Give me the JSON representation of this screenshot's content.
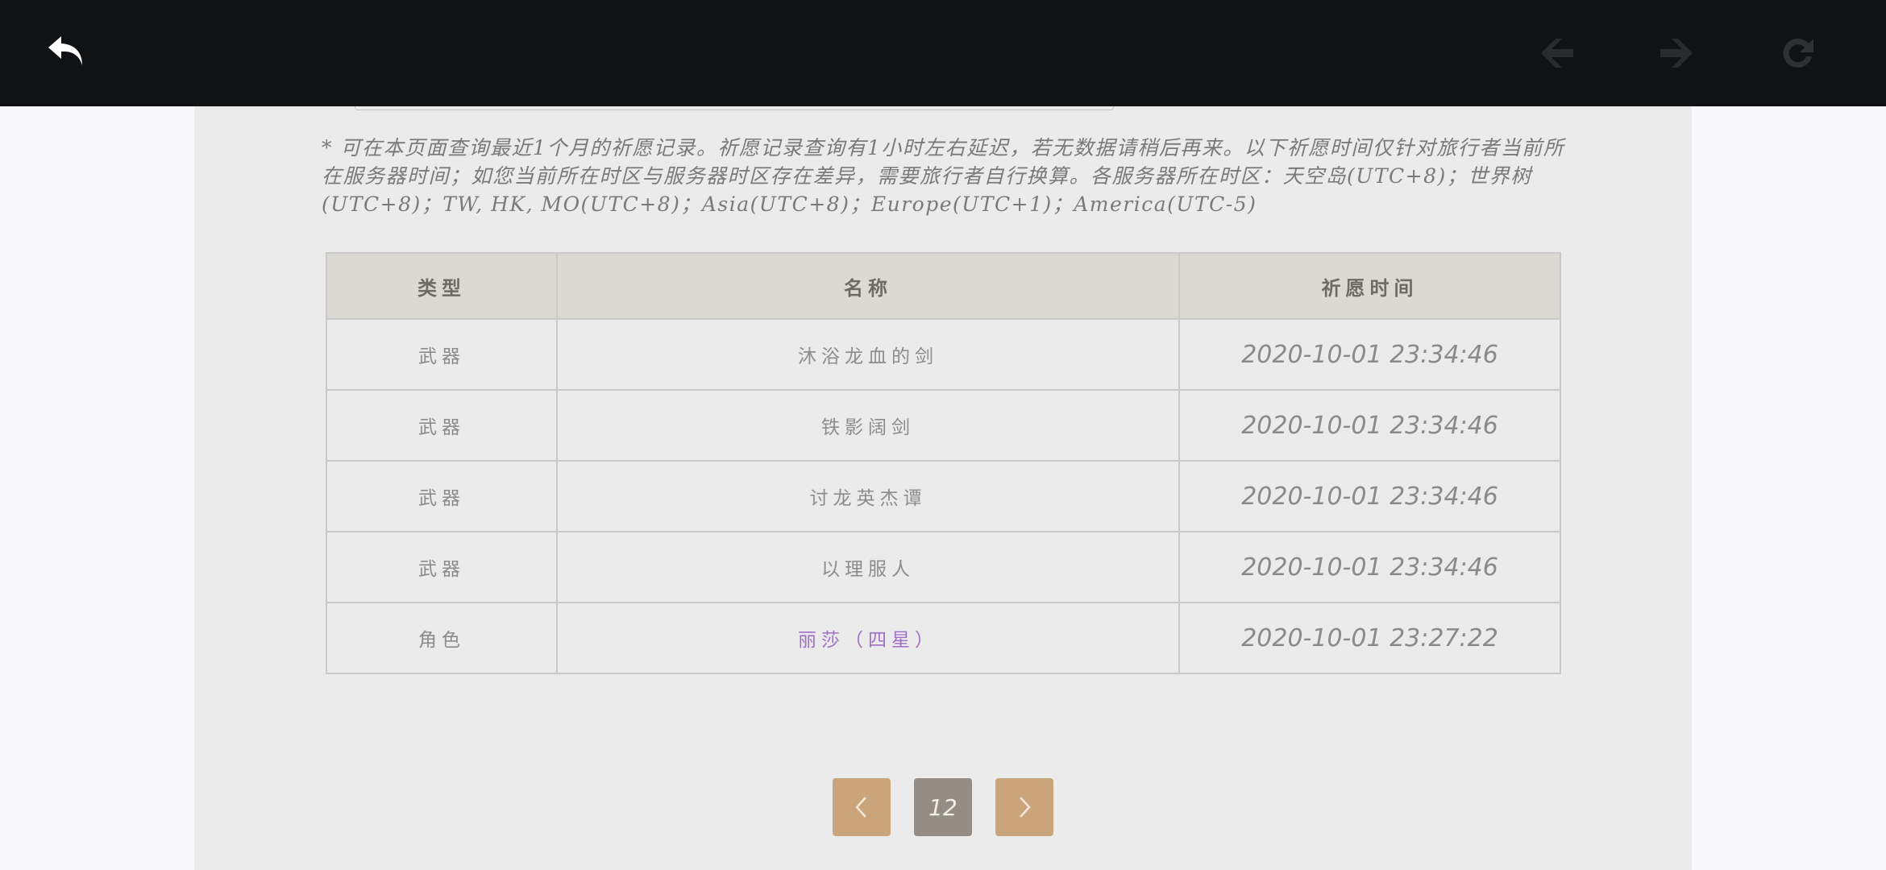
{
  "notice": "* 可在本页面查询最近1个月的祈愿记录。祈愿记录查询有1小时左右延迟，若无数据请稍后再来。以下祈愿时间仅针对旅行者当前所在服务器时间；如您当前所在时区与服务器时区存在差异，需要旅行者自行换算。各服务器所在时区：天空岛(UTC+8)；世界树(UTC+8)；TW, HK, MO(UTC+8)；Asia(UTC+8)；Europe(UTC+1)；America(UTC-5)",
  "table": {
    "headers": {
      "type": "类型",
      "name": "名称",
      "time": "祈愿时间"
    },
    "rows": [
      {
        "type": "武器",
        "name": "沐浴龙血的剑",
        "time": "2020-10-01 23:34:46",
        "highlight": false
      },
      {
        "type": "武器",
        "name": "铁影阔剑",
        "time": "2020-10-01 23:34:46",
        "highlight": false
      },
      {
        "type": "武器",
        "name": "讨龙英杰谭",
        "time": "2020-10-01 23:34:46",
        "highlight": false
      },
      {
        "type": "武器",
        "name": "以理服人",
        "time": "2020-10-01 23:34:46",
        "highlight": false
      },
      {
        "type": "角色",
        "name": "丽莎（四星）",
        "time": "2020-10-01 23:27:22",
        "highlight": true
      }
    ]
  },
  "pagination": {
    "current_page": "12"
  },
  "icons": {
    "back": "back-arrow-icon",
    "nav_back": "diamond-arrow-left-icon",
    "nav_forward": "diamond-arrow-right-icon",
    "reload": "reload-icon",
    "prev": "chevron-left-icon",
    "next": "chevron-right-icon"
  },
  "colors": {
    "topbar": "#111214",
    "content": "#ebebeb",
    "header_row": "#dcd9d4",
    "pager_button": "#caa57c",
    "current_page": "#958c86",
    "four_star": "#a070c8"
  }
}
